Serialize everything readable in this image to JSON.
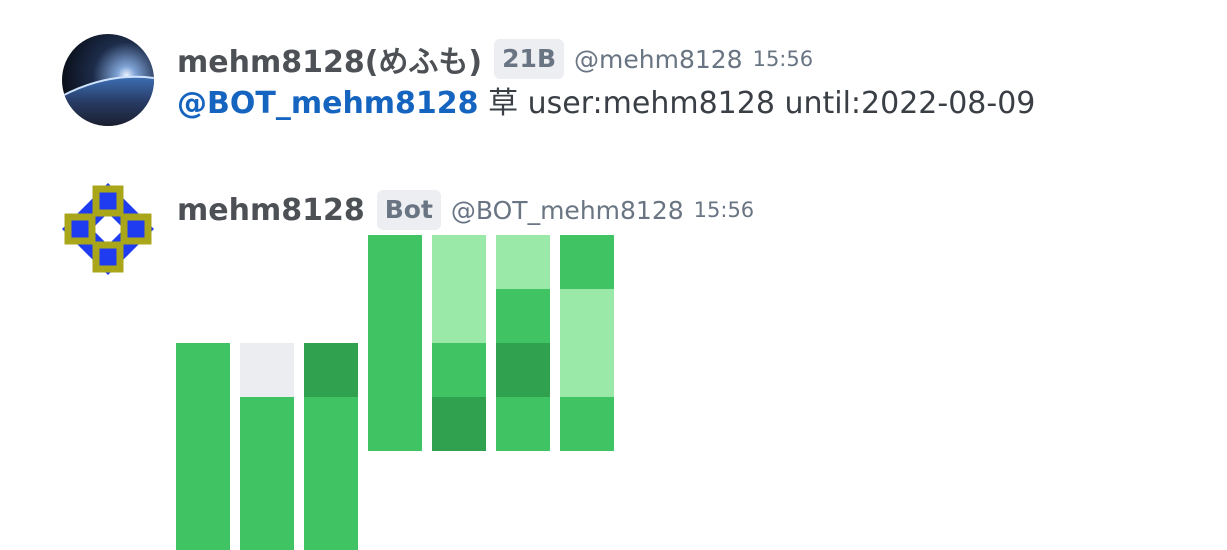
{
  "colors": {
    "level0": "#ebedf0",
    "level1": "#9be9a8",
    "level2": "#40c463",
    "level3": "#30a14e",
    "mention": "#1565c0",
    "badge_bg": "#eceef2"
  },
  "messages": [
    {
      "avatar_icon": "earth-horizon-avatar",
      "display_name": "mehm8128(めふも)",
      "badge": "21B",
      "handle": "@mehm8128",
      "time": "15:56",
      "mention": "@BOT_mehm8128",
      "text": "草 user:mehm8128 until:2022-08-09"
    },
    {
      "avatar_icon": "bot-pattern-avatar",
      "display_name": "mehm8128",
      "badge": "Bot",
      "handle": "@BOT_mehm8128",
      "time": "15:56",
      "contribution_weeks": [
        [
          null,
          null,
          2,
          2,
          2,
          2
        ],
        [
          null,
          null,
          0,
          2,
          2,
          2
        ],
        [
          null,
          null,
          3,
          2,
          2,
          2
        ],
        [
          2,
          2,
          2,
          2,
          null,
          null
        ],
        [
          1,
          1,
          2,
          3,
          null,
          null
        ],
        [
          1,
          2,
          3,
          2,
          null,
          null
        ],
        [
          2,
          1,
          1,
          2,
          null,
          null
        ]
      ]
    }
  ]
}
